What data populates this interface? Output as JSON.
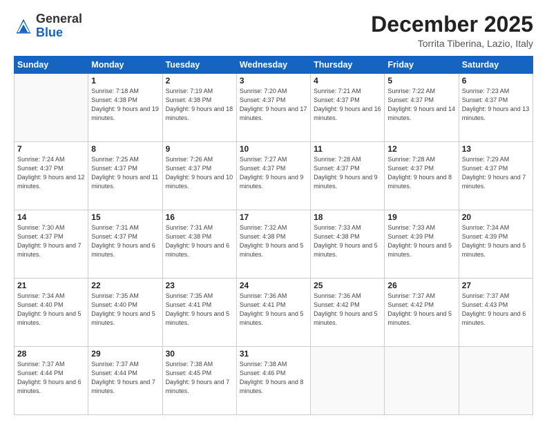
{
  "header": {
    "logo_general": "General",
    "logo_blue": "Blue",
    "month_title": "December 2025",
    "location": "Torrita Tiberina, Lazio, Italy"
  },
  "weekdays": [
    "Sunday",
    "Monday",
    "Tuesday",
    "Wednesday",
    "Thursday",
    "Friday",
    "Saturday"
  ],
  "weeks": [
    [
      {
        "day": "",
        "sunrise": "",
        "sunset": "",
        "daylight": ""
      },
      {
        "day": "1",
        "sunrise": "Sunrise: 7:18 AM",
        "sunset": "Sunset: 4:38 PM",
        "daylight": "Daylight: 9 hours and 19 minutes."
      },
      {
        "day": "2",
        "sunrise": "Sunrise: 7:19 AM",
        "sunset": "Sunset: 4:38 PM",
        "daylight": "Daylight: 9 hours and 18 minutes."
      },
      {
        "day": "3",
        "sunrise": "Sunrise: 7:20 AM",
        "sunset": "Sunset: 4:37 PM",
        "daylight": "Daylight: 9 hours and 17 minutes."
      },
      {
        "day": "4",
        "sunrise": "Sunrise: 7:21 AM",
        "sunset": "Sunset: 4:37 PM",
        "daylight": "Daylight: 9 hours and 16 minutes."
      },
      {
        "day": "5",
        "sunrise": "Sunrise: 7:22 AM",
        "sunset": "Sunset: 4:37 PM",
        "daylight": "Daylight: 9 hours and 14 minutes."
      },
      {
        "day": "6",
        "sunrise": "Sunrise: 7:23 AM",
        "sunset": "Sunset: 4:37 PM",
        "daylight": "Daylight: 9 hours and 13 minutes."
      }
    ],
    [
      {
        "day": "7",
        "sunrise": "Sunrise: 7:24 AM",
        "sunset": "Sunset: 4:37 PM",
        "daylight": "Daylight: 9 hours and 12 minutes."
      },
      {
        "day": "8",
        "sunrise": "Sunrise: 7:25 AM",
        "sunset": "Sunset: 4:37 PM",
        "daylight": "Daylight: 9 hours and 11 minutes."
      },
      {
        "day": "9",
        "sunrise": "Sunrise: 7:26 AM",
        "sunset": "Sunset: 4:37 PM",
        "daylight": "Daylight: 9 hours and 10 minutes."
      },
      {
        "day": "10",
        "sunrise": "Sunrise: 7:27 AM",
        "sunset": "Sunset: 4:37 PM",
        "daylight": "Daylight: 9 hours and 9 minutes."
      },
      {
        "day": "11",
        "sunrise": "Sunrise: 7:28 AM",
        "sunset": "Sunset: 4:37 PM",
        "daylight": "Daylight: 9 hours and 9 minutes."
      },
      {
        "day": "12",
        "sunrise": "Sunrise: 7:28 AM",
        "sunset": "Sunset: 4:37 PM",
        "daylight": "Daylight: 9 hours and 8 minutes."
      },
      {
        "day": "13",
        "sunrise": "Sunrise: 7:29 AM",
        "sunset": "Sunset: 4:37 PM",
        "daylight": "Daylight: 9 hours and 7 minutes."
      }
    ],
    [
      {
        "day": "14",
        "sunrise": "Sunrise: 7:30 AM",
        "sunset": "Sunset: 4:37 PM",
        "daylight": "Daylight: 9 hours and 7 minutes."
      },
      {
        "day": "15",
        "sunrise": "Sunrise: 7:31 AM",
        "sunset": "Sunset: 4:37 PM",
        "daylight": "Daylight: 9 hours and 6 minutes."
      },
      {
        "day": "16",
        "sunrise": "Sunrise: 7:31 AM",
        "sunset": "Sunset: 4:38 PM",
        "daylight": "Daylight: 9 hours and 6 minutes."
      },
      {
        "day": "17",
        "sunrise": "Sunrise: 7:32 AM",
        "sunset": "Sunset: 4:38 PM",
        "daylight": "Daylight: 9 hours and 5 minutes."
      },
      {
        "day": "18",
        "sunrise": "Sunrise: 7:33 AM",
        "sunset": "Sunset: 4:38 PM",
        "daylight": "Daylight: 9 hours and 5 minutes."
      },
      {
        "day": "19",
        "sunrise": "Sunrise: 7:33 AM",
        "sunset": "Sunset: 4:39 PM",
        "daylight": "Daylight: 9 hours and 5 minutes."
      },
      {
        "day": "20",
        "sunrise": "Sunrise: 7:34 AM",
        "sunset": "Sunset: 4:39 PM",
        "daylight": "Daylight: 9 hours and 5 minutes."
      }
    ],
    [
      {
        "day": "21",
        "sunrise": "Sunrise: 7:34 AM",
        "sunset": "Sunset: 4:40 PM",
        "daylight": "Daylight: 9 hours and 5 minutes."
      },
      {
        "day": "22",
        "sunrise": "Sunrise: 7:35 AM",
        "sunset": "Sunset: 4:40 PM",
        "daylight": "Daylight: 9 hours and 5 minutes."
      },
      {
        "day": "23",
        "sunrise": "Sunrise: 7:35 AM",
        "sunset": "Sunset: 4:41 PM",
        "daylight": "Daylight: 9 hours and 5 minutes."
      },
      {
        "day": "24",
        "sunrise": "Sunrise: 7:36 AM",
        "sunset": "Sunset: 4:41 PM",
        "daylight": "Daylight: 9 hours and 5 minutes."
      },
      {
        "day": "25",
        "sunrise": "Sunrise: 7:36 AM",
        "sunset": "Sunset: 4:42 PM",
        "daylight": "Daylight: 9 hours and 5 minutes."
      },
      {
        "day": "26",
        "sunrise": "Sunrise: 7:37 AM",
        "sunset": "Sunset: 4:42 PM",
        "daylight": "Daylight: 9 hours and 5 minutes."
      },
      {
        "day": "27",
        "sunrise": "Sunrise: 7:37 AM",
        "sunset": "Sunset: 4:43 PM",
        "daylight": "Daylight: 9 hours and 6 minutes."
      }
    ],
    [
      {
        "day": "28",
        "sunrise": "Sunrise: 7:37 AM",
        "sunset": "Sunset: 4:44 PM",
        "daylight": "Daylight: 9 hours and 6 minutes."
      },
      {
        "day": "29",
        "sunrise": "Sunrise: 7:37 AM",
        "sunset": "Sunset: 4:44 PM",
        "daylight": "Daylight: 9 hours and 7 minutes."
      },
      {
        "day": "30",
        "sunrise": "Sunrise: 7:38 AM",
        "sunset": "Sunset: 4:45 PM",
        "daylight": "Daylight: 9 hours and 7 minutes."
      },
      {
        "day": "31",
        "sunrise": "Sunrise: 7:38 AM",
        "sunset": "Sunset: 4:46 PM",
        "daylight": "Daylight: 9 hours and 8 minutes."
      },
      {
        "day": "",
        "sunrise": "",
        "sunset": "",
        "daylight": ""
      },
      {
        "day": "",
        "sunrise": "",
        "sunset": "",
        "daylight": ""
      },
      {
        "day": "",
        "sunrise": "",
        "sunset": "",
        "daylight": ""
      }
    ]
  ]
}
